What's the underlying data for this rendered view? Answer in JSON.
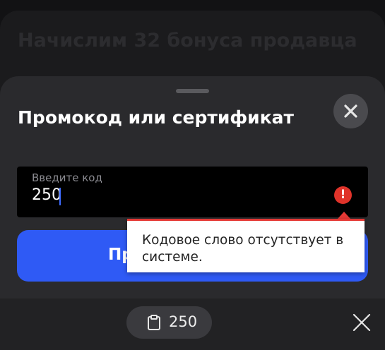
{
  "background": {
    "title": "Начислим 32 бонуса продавца"
  },
  "sheet": {
    "title": "Промокод или сертификат",
    "close_icon": "close-icon"
  },
  "code_field": {
    "label": "Введите код",
    "value": "250",
    "status_icon": "error-icon",
    "status_icon_glyph": "!"
  },
  "submit": {
    "label": "Пр"
  },
  "tooltip": {
    "text": "Кодовое слово отсутствует в системе."
  },
  "keyboard_bar": {
    "clipboard_text": "250",
    "clipboard_icon": "clipboard-icon",
    "close_icon": "close-icon"
  },
  "colors": {
    "accent": "#2f5af5",
    "error": "#e0332a",
    "sheet_bg": "#2a2a2d"
  }
}
